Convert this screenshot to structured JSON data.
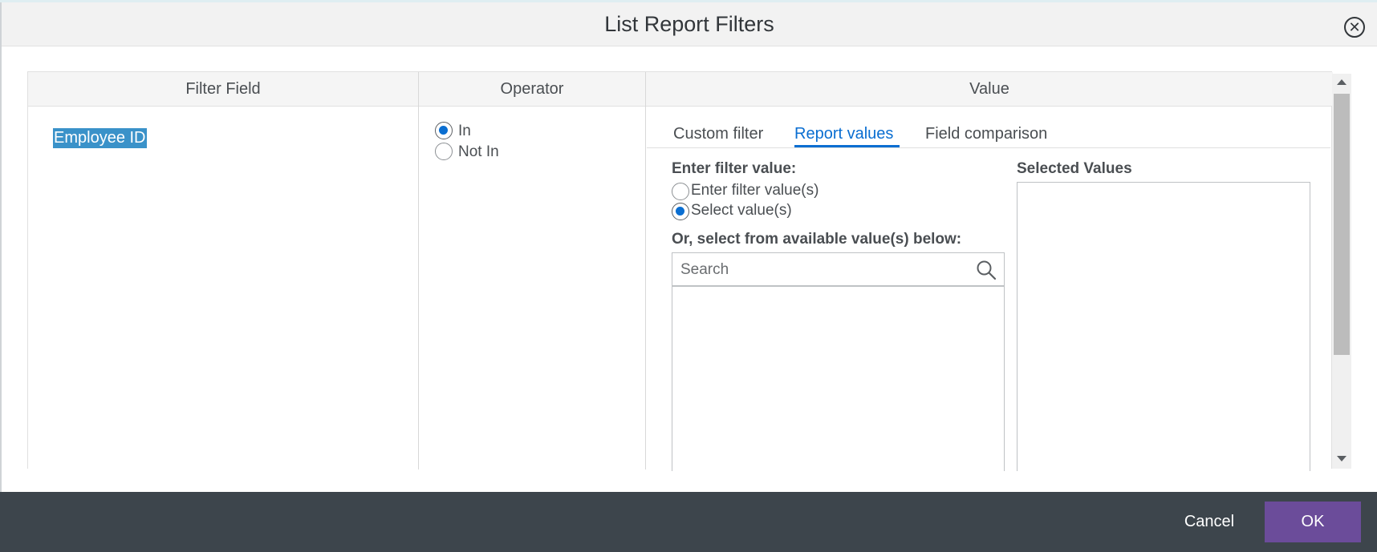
{
  "dialog": {
    "title": "List Report Filters",
    "close_icon": "close-circle-icon"
  },
  "table": {
    "headers": {
      "filter_field": "Filter Field",
      "operator": "Operator",
      "value": "Value"
    },
    "row": {
      "filter_field": "Employee ID",
      "operators": [
        {
          "label": "In",
          "selected": true
        },
        {
          "label": "Not In",
          "selected": false
        }
      ]
    }
  },
  "value_panel": {
    "tabs": [
      {
        "label": "Custom filter",
        "active": false
      },
      {
        "label": "Report values",
        "active": true
      },
      {
        "label": "Field comparison",
        "active": false
      }
    ],
    "enter_filter_label": "Enter filter value:",
    "modes": [
      {
        "label": "Enter filter value(s)",
        "selected": false
      },
      {
        "label": "Select value(s)",
        "selected": true
      }
    ],
    "available_label": "Or, select from available value(s) below:",
    "search": {
      "placeholder": "Search",
      "value": "",
      "icon": "search-icon"
    },
    "selected_label": "Selected Values"
  },
  "footer": {
    "cancel_label": "Cancel",
    "ok_label": "OK"
  },
  "colors": {
    "accent": "#0a6ed1",
    "ok_button": "#6b4c9a",
    "footer": "#3d454c",
    "selection_highlight": "#3a92c9"
  }
}
